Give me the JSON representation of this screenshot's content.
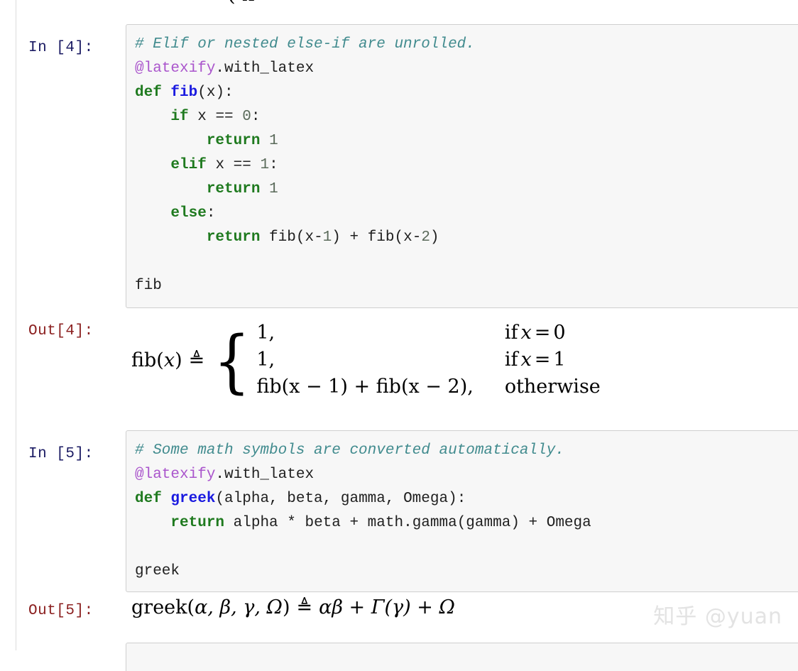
{
  "notebook": {
    "top_fragment": "(   x",
    "watermark": "知乎 @yuan",
    "cells": [
      {
        "type": "code",
        "prompt_in": "In [4]:",
        "prompt_out": "Out[4]:",
        "source_lines": [
          "# Elif or nested else-if are unrolled.",
          "@latexify.with_latex",
          "def fib(x):",
          "    if x == 0:",
          "        return 1",
          "    elif x == 1:",
          "        return 1",
          "    else:",
          "        return fib(x-1) + fib(x-2)",
          "",
          "fib"
        ],
        "tokens": {
          "comment": "# Elif or nested else-if are unrolled.",
          "decorator_name": "@latexify",
          "decorator_attr": ".with_latex",
          "kw_def": "def",
          "func_name": "fib",
          "func_sig": "(x):",
          "kw_if": "if",
          "if_expr": " x == ",
          "if_num": "0",
          "if_colon": ":",
          "kw_return_1": "return",
          "return_num_1": "1",
          "kw_elif": "elif",
          "elif_expr": " x == ",
          "elif_num": "1",
          "elif_colon": ":",
          "kw_return_2": "return",
          "return_num_2": "1",
          "kw_else": "else",
          "else_colon": ":",
          "kw_return_3": "return",
          "return_expr_a": " fib(x-",
          "return_num_3a": "1",
          "return_expr_b": ") + fib(x-",
          "return_num_3b": "2",
          "return_expr_c": ")",
          "tail": "fib"
        },
        "output": {
          "kind": "math-piecewise",
          "lhs": "fib(x) ≜",
          "lhs_name": "fib",
          "lhs_open": "(",
          "lhs_var": "x",
          "lhs_close": ")",
          "lhs_rel": "≜",
          "rows": [
            {
              "value": "1,",
              "condition": "if x = 0",
              "cond_kw": "if",
              "cond_var": "x",
              "cond_rel": "=",
              "cond_num": "0"
            },
            {
              "value": "1,",
              "condition": "if x = 1",
              "cond_kw": "if",
              "cond_var": "x",
              "cond_rel": "=",
              "cond_num": "1"
            },
            {
              "value": "fib(x − 1) + fib(x − 2),",
              "condition": "otherwise"
            }
          ]
        }
      },
      {
        "type": "code",
        "prompt_in": "In [5]:",
        "prompt_out": "Out[5]:",
        "source_lines": [
          "# Some math symbols are converted automatically.",
          "@latexify.with_latex",
          "def greek(alpha, beta, gamma, Omega):",
          "    return alpha * beta + math.gamma(gamma) + Omega",
          "",
          "greek"
        ],
        "tokens": {
          "comment": "# Some math symbols are converted automatically.",
          "decorator_name": "@latexify",
          "decorator_attr": ".with_latex",
          "kw_def": "def",
          "func_name": "greek",
          "func_sig": "(alpha, beta, gamma, Omega):",
          "kw_return": "return",
          "return_expr": " alpha * beta + math.gamma(gamma) + Omega",
          "tail": "greek"
        },
        "output": {
          "kind": "math-inline",
          "name": "greek",
          "open": "(",
          "args": "α, β, γ, Ω",
          "close": ")",
          "rel": "≜",
          "rhs": "αβ + Γ(γ) + Ω",
          "full": "greek(α, β, γ, Ω) ≜ αβ + Γ(γ) + Ω"
        }
      }
    ]
  },
  "colors": {
    "cell_background": "#f7f7f7",
    "cell_border": "#cfcfcf",
    "prompt_in": "#1b1b63",
    "prompt_out": "#8b2020",
    "comment": "#418b8e",
    "keyword": "#1f7a1f",
    "decorator": "#aa55cc",
    "function_name": "#1a1ae0",
    "number": "#5a6a5a",
    "text": "#202020",
    "watermark": "#e3e3e3",
    "left_rule": "#dcdcdc"
  }
}
